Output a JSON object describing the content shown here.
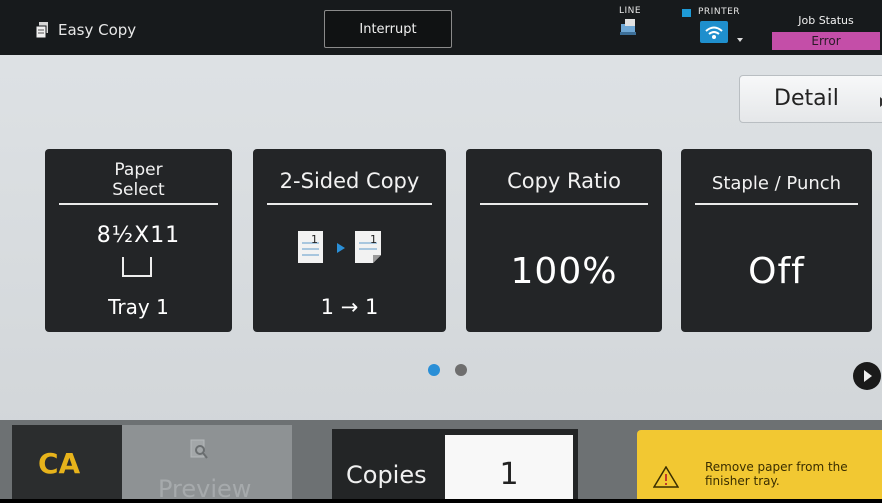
{
  "header": {
    "mode_label": "Easy Copy",
    "interrupt_label": "Interrupt",
    "line_label": "LINE",
    "printer_label": "PRINTER",
    "job_status_label": "Job Status",
    "job_status_value": "Error"
  },
  "detail_label": "Detail",
  "tiles": {
    "paper_select": {
      "title_line1": "Paper",
      "title_line2": "Select",
      "size": "8½X11",
      "tray": "Tray 1"
    },
    "two_sided": {
      "title": "2-Sided Copy",
      "mode": "1 → 1",
      "page_num": "1"
    },
    "copy_ratio": {
      "title": "Copy Ratio",
      "value": "100%"
    },
    "staple_punch": {
      "title": "Staple / Punch",
      "value": "Off"
    }
  },
  "pagination": {
    "current": 1,
    "total": 2
  },
  "bottom": {
    "ca_label": "CA",
    "preview_label": "Preview",
    "copies_label": "Copies",
    "copies_value": "1",
    "alert_text": "Remove paper from the finisher tray."
  },
  "icons": {
    "mode": "copy-icon",
    "line": "fax-line-icon",
    "printer": "wifi-icon",
    "tray": "tray-icon",
    "duplex": "duplex-pages-icon",
    "next": "next-page-icon",
    "preview": "preview-icon",
    "alert": "warning-icon"
  },
  "colors": {
    "accent_blue": "#2a8fd7",
    "error_magenta": "#c44ea8",
    "ca_yellow": "#e7b31b",
    "alert_yellow": "#f2c832"
  }
}
